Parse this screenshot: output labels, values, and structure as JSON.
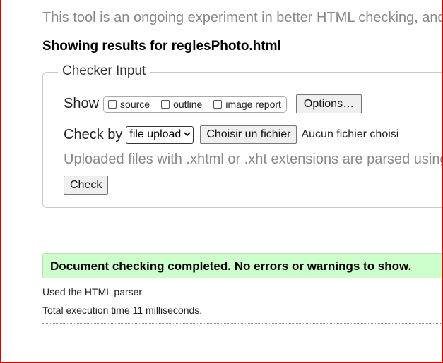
{
  "intro": {
    "text": "This tool is an ongoing experiment in better HTML checking, and"
  },
  "results_heading": "Showing results for reglesPhoto.html",
  "checker_input": {
    "legend": "Checker Input",
    "show_label": "Show",
    "show_options": [
      {
        "label": "source",
        "checked": false
      },
      {
        "label": "outline",
        "checked": false
      },
      {
        "label": "image report",
        "checked": false
      }
    ],
    "options_button": "Options…",
    "check_by_label": "Check by",
    "check_by_selected": "file upload",
    "file_button": "Choisir un fichier",
    "file_status": "Aucun fichier choisi",
    "note": "Uploaded files with .xhtml or .xht extensions are parsed using",
    "check_button": "Check"
  },
  "result": {
    "success_message": "Document checking completed. No errors or warnings to show.",
    "parser_info": "Used the HTML parser.",
    "execution_time": "Total execution time 11 milliseconds."
  },
  "colors": {
    "success_bg": "#ccffcc",
    "muted_text": "#888888",
    "frame_border": "#e00000"
  }
}
